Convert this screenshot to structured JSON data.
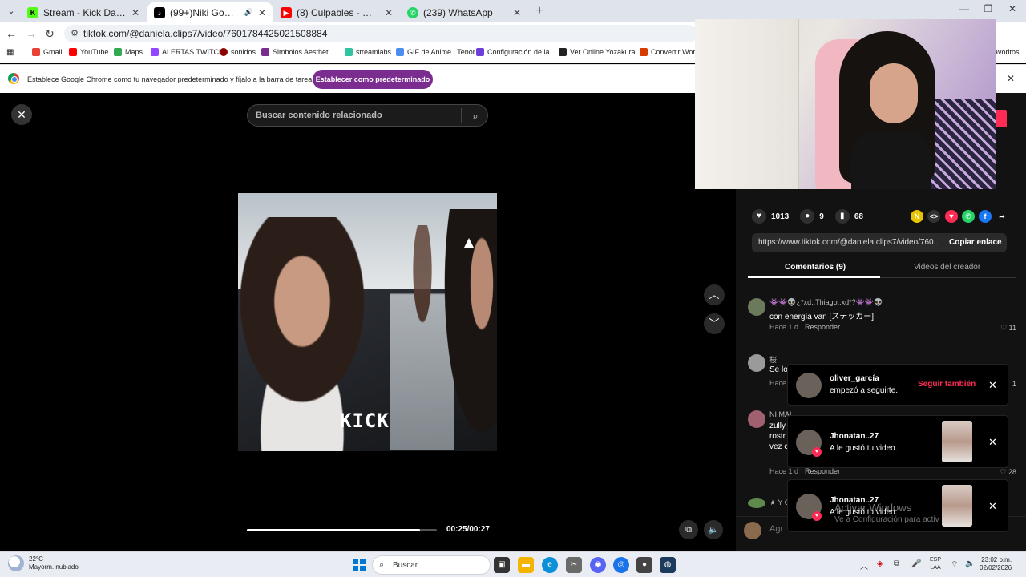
{
  "browser": {
    "tabs": [
      {
        "title": "Stream - Kick Dashboard",
        "active": false,
        "favicon_color": "#53fc18"
      },
      {
        "title": "(99+)Niki Gomez🖤 (@nico",
        "active": true,
        "favicon_color": "#000000"
      },
      {
        "title": "(8) Culpables - MTZ Manuel Tu",
        "active": false,
        "favicon_color": "#ff0000"
      },
      {
        "title": "(239) WhatsApp",
        "active": false,
        "favicon_color": "#25d366"
      }
    ],
    "new_tab_label": "+",
    "window_controls": {
      "minimize": "—",
      "maximize": "❐",
      "close": "✕"
    },
    "url": "tiktok.com/@daniela.clips7/video/7601784425021508884",
    "bookmarks": [
      {
        "label": "Gmail",
        "color": "#ea4335"
      },
      {
        "label": "YouTube",
        "color": "#ff0000"
      },
      {
        "label": "Maps",
        "color": "#34a853"
      },
      {
        "label": "ALERTAS TWITCH",
        "color": "#9146ff"
      },
      {
        "label": "sonidos",
        "color": "#8b0000"
      },
      {
        "label": "Simbolos Aesthet...",
        "color": "#7b2d8f"
      },
      {
        "label": "streamlabs",
        "color": "#31c3a2"
      },
      {
        "label": "GIF de Anime | Tenor",
        "color": "#4a8ff0"
      },
      {
        "label": "Configuración de la...",
        "color": "#6e3fd6"
      },
      {
        "label": "Ver Online Yozakura...",
        "color": "#222222"
      },
      {
        "label": "Convertir Word",
        "color": "#d83b01"
      }
    ],
    "bookmarks_trailing": "avoritos",
    "infobar": {
      "message": "Establece Google Chrome como tu navegador predeterminado y fíjalo a la barra de tareas",
      "button": "Establecer como predeterminado"
    }
  },
  "player": {
    "close_label": "✕",
    "search_placeholder": "Buscar contenido relacionado",
    "watermark": "KICK",
    "time": "00:25/00:27",
    "progress": 0.91,
    "nav_up": "︿",
    "nav_down": "﹀"
  },
  "panel": {
    "likes": "1013",
    "comments_count": "9",
    "saves": "68",
    "share_link": "https://www.tiktok.com/@daniela.clips7/video/760...",
    "copy_label": "Copiar enlace",
    "tab_comments": "Comentarios (9)",
    "tab_creator": "Videos del creador",
    "comments": [
      {
        "name": "👾👾👽¿*xd..Thiago..xd*?👾👾👽",
        "text": "con energía van [ステッカー]",
        "time": "Hace 1 d",
        "reply": "Responder",
        "likes": "11",
        "avatar_color": "#6b7a5a"
      },
      {
        "name": "桜",
        "text": "Se lo",
        "time": "Hace",
        "reply": "",
        "likes": "1",
        "avatar_color": "#9a9a9a"
      },
      {
        "name": "NI MAL",
        "text": "zully",
        "text2": "rostr",
        "text3": "vez c",
        "time": "Hace 1 d",
        "reply": "Responder",
        "likes": "28",
        "avatar_color": "#a06070"
      },
      {
        "name": "★ Y C",
        "text": "",
        "time": "",
        "reply": "",
        "likes": "",
        "avatar_color": "#5f8a4c"
      }
    ],
    "comment_input_placeholder": "Agr"
  },
  "notifications": [
    {
      "name": "oliver_garcía",
      "message": "empezó a seguirte.",
      "action": "Seguir también",
      "type": "follow"
    },
    {
      "name": "Jhonatan..27",
      "message": "A le gustó tu video.",
      "type": "like"
    },
    {
      "name": "Jhonatan..27",
      "message": "A le gustó tu video.",
      "type": "like"
    }
  ],
  "windows_watermark": {
    "line1": "Activar Windows",
    "line2": "Ve a Configuración para activ"
  },
  "taskbar": {
    "weather_temp": "22°C",
    "weather_desc": "Mayorm. nublado",
    "search_label": "Buscar",
    "lang_line1": "ESP",
    "lang_line2": "LAA",
    "time": "23:02 p.m.",
    "date": "02/02/2026"
  }
}
